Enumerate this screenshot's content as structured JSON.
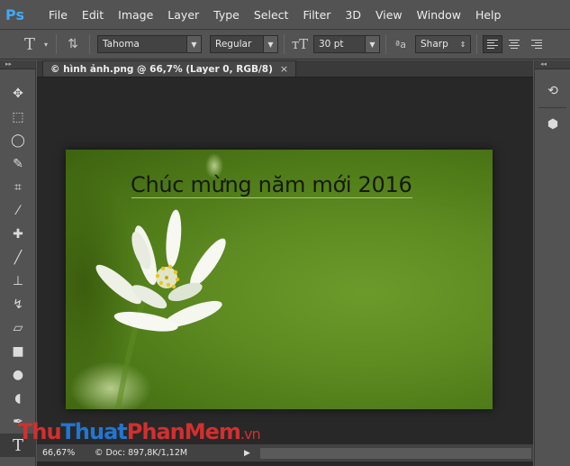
{
  "app": {
    "logo": "Ps"
  },
  "menu": [
    "File",
    "Edit",
    "Image",
    "Layer",
    "Type",
    "Select",
    "Filter",
    "3D",
    "View",
    "Window",
    "Help"
  ],
  "options": {
    "font_family": "Tahoma",
    "font_style": "Regular",
    "font_size": "30 pt",
    "aa_label": "ªa",
    "antialias": "Sharp"
  },
  "document": {
    "tab_title": "© hình ảnh.png @ 66,7% (Layer 0, RGB/8)",
    "tab_close": "×",
    "canvas_text": "Chúc mừng năm mới 2016",
    "zoom": "66,67%",
    "doc_info": "© Doc: 897,8K/1,12M"
  },
  "watermark": {
    "part1": "Thu",
    "part2": "Thuat",
    "part3": "PhanMem",
    "part4": ".vn"
  },
  "colors": {
    "bg": "#535353",
    "canvas_bg": "#282828",
    "accent": "#3fa9f5"
  }
}
